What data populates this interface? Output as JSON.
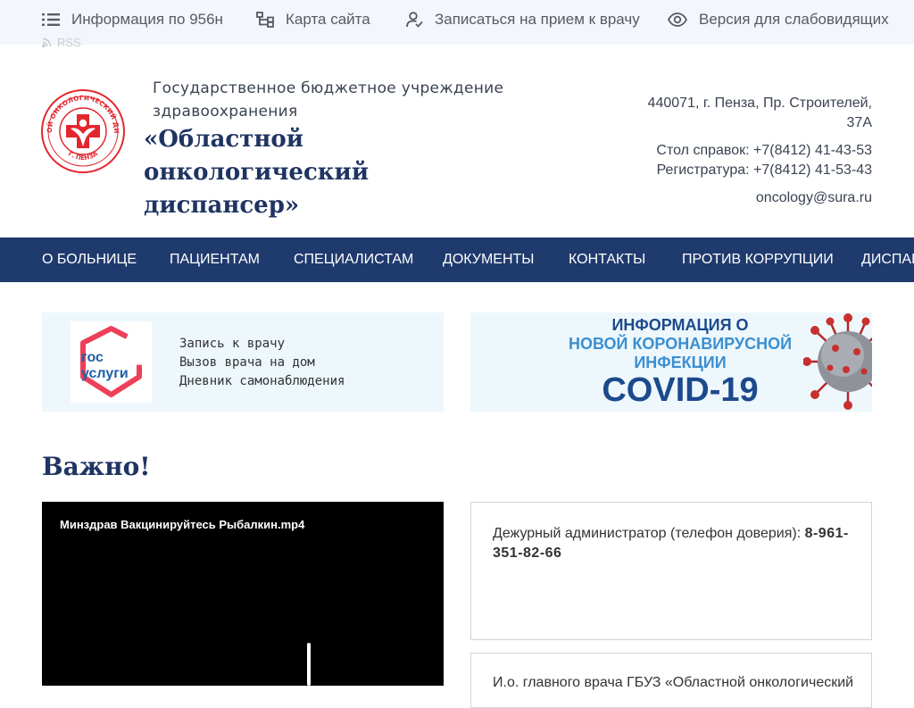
{
  "topbar": {
    "info": "Информация по 956н",
    "sitemap": "Карта сайта",
    "appointment": "Записаться на прием к врачу",
    "accessibility": "Версия для слабовидящих",
    "rss": "RSS"
  },
  "header": {
    "org_sub_line1": "Государственное бюджетное учреждение",
    "org_sub_line2": "здравоохранения",
    "org_name_line1": "«Областной онкологический",
    "org_name_line2": "диспансер»",
    "logo_text_top": "ОБЛАСТНОЙ ОНКОЛОГИЧЕСКИЙ ДИСПАНСЕР",
    "logo_text_bottom": "Г. ПЕНЗА"
  },
  "contacts": {
    "address_line1": "440071, г. Пенза, Пр. Строителей,",
    "address_line2": "37А",
    "help_desk": "Стол справок: +7(8412) 41-43-53",
    "registry": "Регистратура: +7(8412) 41-53-43",
    "email": "oncology@sura.ru"
  },
  "nav": {
    "items": [
      "О БОЛЬНИЦЕ",
      "ПАЦИЕНТАМ",
      "СПЕЦИАЛИСТАМ",
      "ДОКУМЕНТЫ",
      "КОНТАКТЫ",
      "ПРОТИВ КОРРУПЦИИ",
      "ДИСПАНСЕРИЗАЦИЯ"
    ]
  },
  "gosuslugi": {
    "logo_line1": "гос",
    "logo_line2": "услуги",
    "links": [
      "Запись к врачу",
      "Вызов врача на дом",
      "Дневник самонаблюдения"
    ]
  },
  "covid": {
    "line1": "ИНФОРМАЦИЯ О",
    "line2": "НОВОЙ КОРОНАВИРУСНОЙ",
    "line3": "ИНФЕКЦИИ",
    "line4": "COVID-19"
  },
  "important": {
    "title": "Важно!",
    "video_title": "Минздрав Вакцинируйтесь Рыбалкин.mp4",
    "card1_text": "Дежурный администратор (телефон доверия): ",
    "card1_phone": "8-961-351-82-66",
    "card2_text": "И.о. главного врача ГБУЗ «Областной онкологический"
  },
  "colors": {
    "nav_bg": "#1f3a6d",
    "title": "#1f3462",
    "topbar_bg": "#f3f6fb",
    "banner_bg": "#edf7fc",
    "logo_red": "#e3262d"
  }
}
